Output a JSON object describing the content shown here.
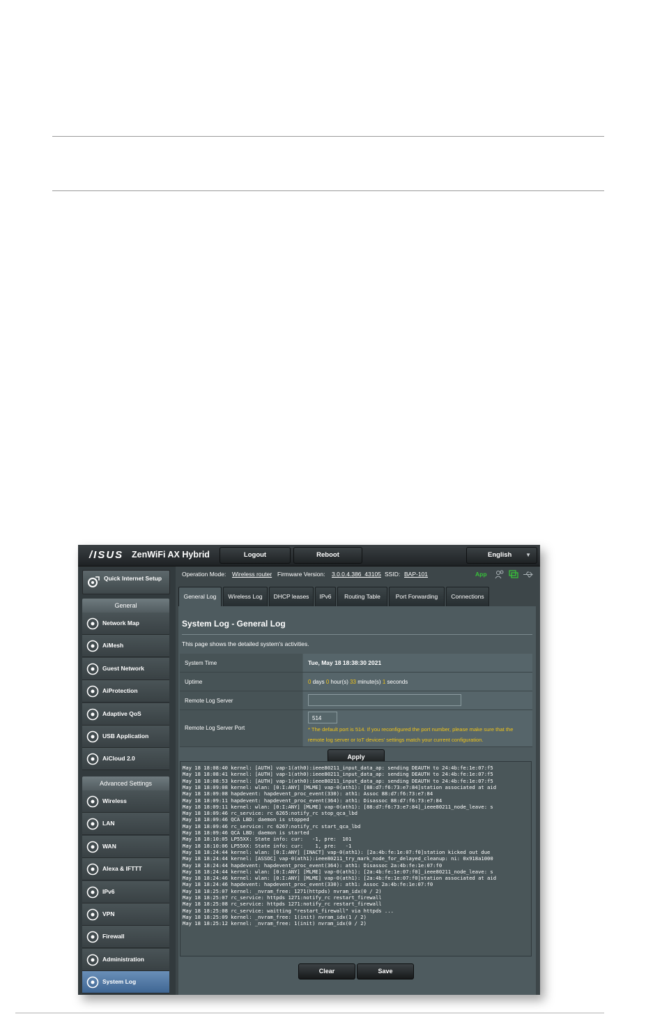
{
  "router": {
    "brand": "/ISUS",
    "product": "ZenWiFi AX Hybrid",
    "logout_label": "Logout",
    "reboot_label": "Reboot",
    "language": "English"
  },
  "sidebar": {
    "quick_setup": "Quick Internet Setup",
    "general_heading": "General",
    "general_items": [
      {
        "label": "Network Map",
        "icon": "network-map-icon"
      },
      {
        "label": "AiMesh",
        "icon": "aimesh-icon"
      },
      {
        "label": "Guest Network",
        "icon": "guest-network-icon"
      },
      {
        "label": "AiProtection",
        "icon": "aiprotection-icon"
      },
      {
        "label": "Adaptive QoS",
        "icon": "adaptive-qos-icon"
      },
      {
        "label": "USB Application",
        "icon": "usb-application-icon"
      },
      {
        "label": "AiCloud 2.0",
        "icon": "aicloud-icon"
      }
    ],
    "advanced_heading": "Advanced Settings",
    "advanced_items": [
      {
        "label": "Wireless",
        "icon": "wireless-icon"
      },
      {
        "label": "LAN",
        "icon": "lan-icon"
      },
      {
        "label": "WAN",
        "icon": "wan-icon"
      },
      {
        "label": "Alexa & IFTTT",
        "icon": "alexa-icon"
      },
      {
        "label": "IPv6",
        "icon": "ipv6-icon"
      },
      {
        "label": "VPN",
        "icon": "vpn-icon"
      },
      {
        "label": "Firewall",
        "icon": "firewall-icon"
      },
      {
        "label": "Administration",
        "icon": "administration-icon"
      },
      {
        "label": "System Log",
        "icon": "system-log-icon"
      }
    ],
    "active_item": "System Log"
  },
  "status": {
    "op_mode_label": "Operation Mode:",
    "op_mode_value": "Wireless router",
    "firmware_label": "Firmware Version:",
    "firmware_value": "3.0.0.4.386_43105",
    "ssid_label": "SSID:",
    "ssid_value": "BAP-101",
    "app_label": "App"
  },
  "tabs": [
    "General Log",
    "Wireless Log",
    "DHCP leases",
    "IPv6",
    "Routing Table",
    "Port Forwarding",
    "Connections"
  ],
  "active_tab": "General Log",
  "panel": {
    "title": "System Log - General Log",
    "description": "This page shows the detailed system's activities.",
    "system_time_label": "System Time",
    "system_time_value": "Tue, May 18 18:38:30 2021",
    "uptime_label": "Uptime",
    "uptime": {
      "days": "0",
      "days_unit": "days",
      "hours": "0",
      "hours_unit": "hour(s)",
      "minutes": "33",
      "minutes_unit": "minute(s)",
      "seconds": "1",
      "seconds_unit": "seconds"
    },
    "remote_server_label": "Remote Log Server",
    "remote_server_value": "",
    "remote_port_label": "Remote Log Server Port",
    "remote_port_value": "514",
    "port_note_1": "* The default port is 514. If you reconfigured the port number, please make sure that the",
    "port_note_2": "remote log server or IoT devices' settings match your current configuration.",
    "apply_label": "Apply",
    "clear_label": "Clear",
    "save_label": "Save"
  },
  "log_lines": [
    "May 18 18:08:40 kernel: [AUTH] vap-1(ath0):ieee80211_input_data_ap: sending DEAUTH to 24:4b:fe:1e:07:f5",
    "May 18 18:08:41 kernel: [AUTH] vap-1(ath0):ieee80211_input_data_ap: sending DEAUTH to 24:4b:fe:1e:07:f5",
    "May 18 18:08:53 kernel: [AUTH] vap-1(ath0):ieee80211_input_data_ap: sending DEAUTH to 24:4b:fe:1e:07:f5",
    "May 18 18:09:08 kernel: wlan: [0:I:ANY] [MLME] vap-0(ath1): [88:d7:f6:73:e7:84]station associated at aid",
    "May 18 18:09:08 hapdevent: hapdevent_proc_event(330): ath1: Assoc 88:d7:f6:73:e7:84",
    "May 18 18:09:11 hapdevent: hapdevent_proc_event(364): ath1: Disassoc 88:d7:f6:73:e7:84",
    "May 18 18:09:11 kernel: wlan: [0:I:ANY] [MLME] vap-0(ath1): [88:d7:f6:73:e7:84]_ieee80211_node_leave: s",
    "May 18 18:09:46 rc_service: rc 6265:notify_rc stop_qca_lbd",
    "May 18 18:09:46 QCA LBD: daemon is stopped",
    "May 18 18:09:46 rc_service: rc 6267:notify_rc start_qca_lbd",
    "May 18 18:09:46 QCA LBD: daemon is started",
    "May 18 18:10:05 LP55XX: State info: cur:   -1, pre:  101",
    "May 18 18:10:06 LP55XX: State info: cur:    1, pre:   -1",
    "May 18 18:24:44 kernel: wlan: [0:I:ANY] [INACT] vap-0(ath1): [2a:4b:fe:1e:07:f0]station kicked out due",
    "May 18 18:24:44 kernel: [ASSOC] vap-0(ath1):ieee80211_try_mark_node_for_delayed_cleanup: ni: 0x918a1000",
    "May 18 18:24:44 hapdevent: hapdevent_proc_event(364): ath1: Disassoc 2a:4b:fe:1e:07:f0",
    "May 18 18:24:44 kernel: wlan: [0:I:ANY] [MLME] vap-0(ath1): [2a:4b:fe:1e:07:f0]_ieee80211_node_leave: s",
    "May 18 18:24:46 kernel: wlan: [0:I:ANY] [MLME] vap-0(ath1): [2a:4b:fe:1e:07:f0]station associated at aid",
    "May 18 18:24:46 hapdevent: hapdevent_proc_event(330): ath1: Assoc 2a:4b:fe:1e:07:f0",
    "May 18 18:25:07 kernel: _nvram_free: 1271(httpds) nvram_idx(0 / 2)",
    "May 18 18:25:07 rc_service: httpds 1271:notify_rc restart_firewall",
    "May 18 18:25:08 rc_service: httpds 1271:notify_rc restart_firewall",
    "May 18 18:25:08 rc_service: waitting \"restart_firewall\" via httpds ...",
    "May 18 18:25:09 kernel: _nvram_free: 1(init) nvram_idx(1 / 2)",
    "May 18 18:25:12 kernel: _nvram_free: 1(init) nvram_idx(0 / 2)"
  ]
}
